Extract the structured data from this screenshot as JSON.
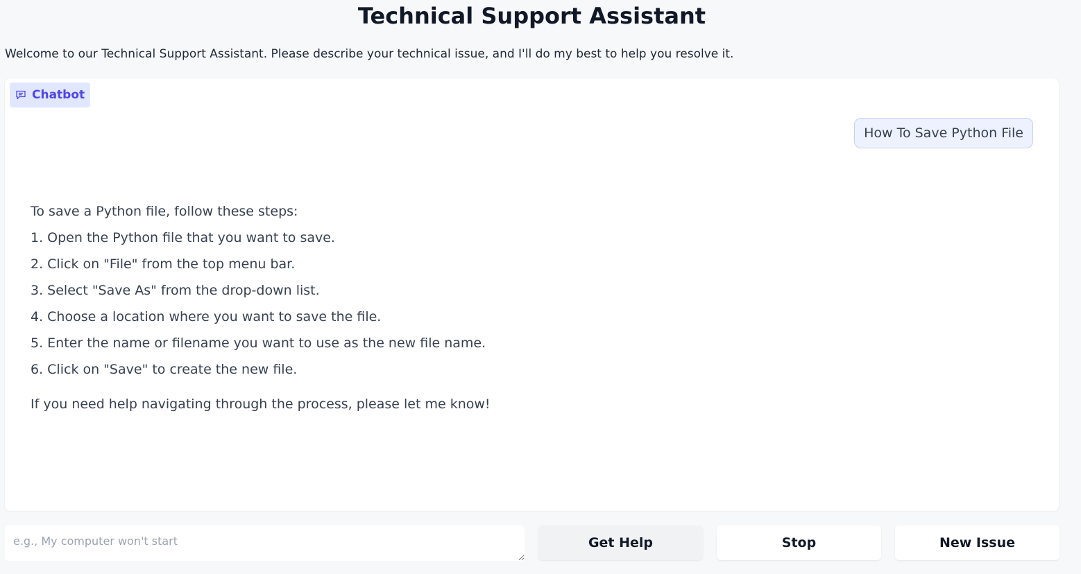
{
  "header": {
    "title": "Technical Support Assistant",
    "description": "Welcome to our Technical Support Assistant. Please describe your technical issue, and I'll do my best to help you resolve it."
  },
  "chatbot": {
    "label": "Chatbot",
    "label_icon": "chat-bubble-icon",
    "accent_color": "#4f46e5",
    "messages": {
      "user": "How To Save Python File",
      "bot": {
        "intro": "To save a Python file, follow these steps:",
        "steps": [
          "1. Open the Python file that you want to save.",
          "2. Click on \"File\" from the top menu bar.",
          "3. Select \"Save As\" from the drop-down list.",
          "4. Choose a location where you want to save the file.",
          "5. Enter the name or filename you want to use as the new file name.",
          "6. Click on \"Save\" to create the new file."
        ],
        "closing": "If you need help navigating through the process, please let me know!"
      }
    }
  },
  "input": {
    "placeholder": "e.g., My computer won't start",
    "value": ""
  },
  "buttons": {
    "get_help": "Get Help",
    "stop": "Stop",
    "new_issue": "New Issue"
  }
}
